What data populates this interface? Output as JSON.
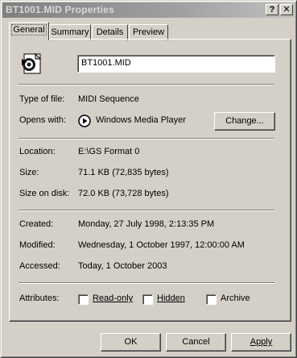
{
  "window": {
    "title": "BT1001.MID Properties",
    "help_glyph": "?",
    "close_glyph": "✕"
  },
  "tabs": [
    {
      "label": "General",
      "active": true
    },
    {
      "label": "Summary",
      "active": false
    },
    {
      "label": "Details",
      "active": false
    },
    {
      "label": "Preview",
      "active": false
    }
  ],
  "general": {
    "file_icon": "midi-file-icon",
    "file_name": "BT1001.MID",
    "type_label": "Type of file:",
    "type_value": "MIDI Sequence",
    "opens_label": "Opens with:",
    "opens_icon": "windows-media-player-icon",
    "opens_value": "Windows Media Player",
    "change_button": "Change...",
    "location_label": "Location:",
    "location_value": "E:\\GS Format 0",
    "size_label": "Size:",
    "size_value": "71.1 KB (72,835 bytes)",
    "size_on_disk_label": "Size on disk:",
    "size_on_disk_value": "72.0 KB (73,728 bytes)",
    "created_label": "Created:",
    "created_value": "Monday, 27 July 1998, 2:13:35 PM",
    "modified_label": "Modified:",
    "modified_value": "Wednesday, 1 October 1997, 12:00:00 AM",
    "accessed_label": "Accessed:",
    "accessed_value": "Today, 1 October 2003",
    "attributes_label": "Attributes:",
    "attributes": [
      {
        "label": "Read-only",
        "checked": false
      },
      {
        "label": "Hidden",
        "checked": false
      },
      {
        "label": "Archive",
        "checked": false
      }
    ]
  },
  "footer": {
    "ok": "OK",
    "cancel": "Cancel",
    "apply": "Apply"
  }
}
